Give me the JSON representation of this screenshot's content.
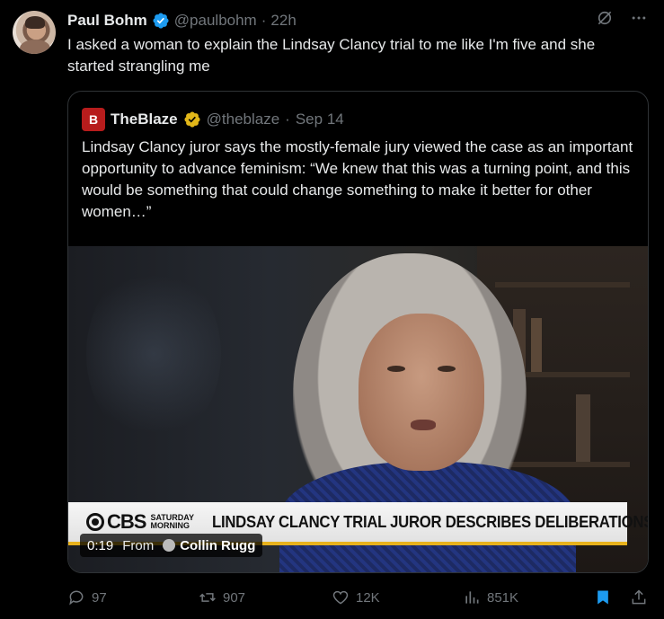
{
  "author": {
    "name": "Paul Bohm",
    "handle": "@paulbohm",
    "separator": "·",
    "time": "22h"
  },
  "tweet_text": "I asked a woman to explain the Lindsay Clancy trial to me like I'm five and she started strangling me",
  "quote": {
    "name": "TheBlaze",
    "handle": "@theblaze",
    "separator": "·",
    "date": "Sep 14",
    "text": "Lindsay Clancy juror says the mostly-female jury viewed the case as an important opportunity to advance feminism: “We knew that this was a turning point, and this would be something that could change something to make it better for other women…”",
    "video": {
      "network": "CBS",
      "show_line1": "SATURDAY",
      "show_line2": "MORNING",
      "headline": "LINDSAY CLANCY TRIAL JUROR DESCRIBES DELIBERATIONS",
      "duration": "0:19",
      "from_label": "From",
      "source": "Collin Rugg"
    }
  },
  "actions": {
    "replies": "97",
    "reposts": "907",
    "likes": "12K",
    "views": "851K"
  },
  "colors": {
    "background": "#000000",
    "text": "#e7e9ea",
    "muted": "#71767b",
    "verified_blue": "#1d9bf0",
    "verified_gold": "#e2b719",
    "bookmark_blue": "#1d9bf0",
    "lower_third_yellow": "#e8b21d"
  },
  "icons": [
    "grok-icon",
    "more-icon",
    "reply-icon",
    "repost-icon",
    "like-icon",
    "views-icon",
    "bookmark-icon",
    "share-icon"
  ]
}
